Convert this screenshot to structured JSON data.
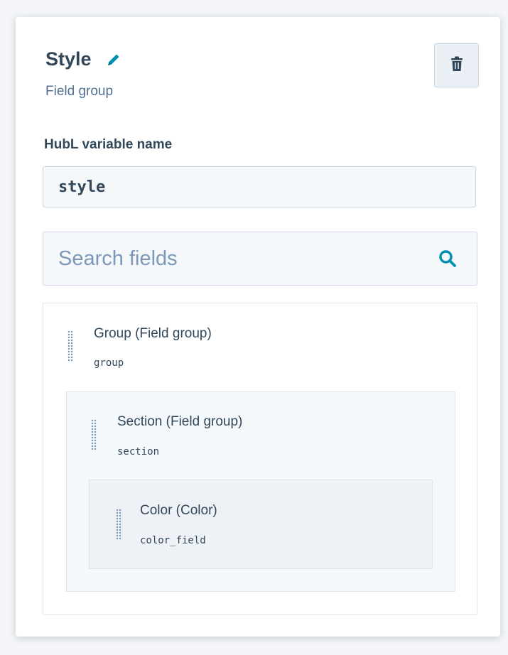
{
  "header": {
    "title": "Style",
    "subtitle": "Field group",
    "edit_icon": "pencil-icon",
    "delete_icon": "trash-icon"
  },
  "variable": {
    "label": "HubL variable name",
    "value": "style"
  },
  "search": {
    "placeholder": "Search fields",
    "value": "",
    "icon": "search-icon"
  },
  "fields": [
    {
      "name": "Group (Field group)",
      "variable": "group"
    },
    {
      "name": "Section (Field group)",
      "variable": "section"
    },
    {
      "name": "Color (Color)",
      "variable": "color_field"
    }
  ],
  "colors": {
    "text_primary": "#33475b",
    "text_secondary": "#516f90",
    "accent": "#0091ae",
    "input_bg": "#f5f8fa",
    "border": "#cbd6e2"
  }
}
